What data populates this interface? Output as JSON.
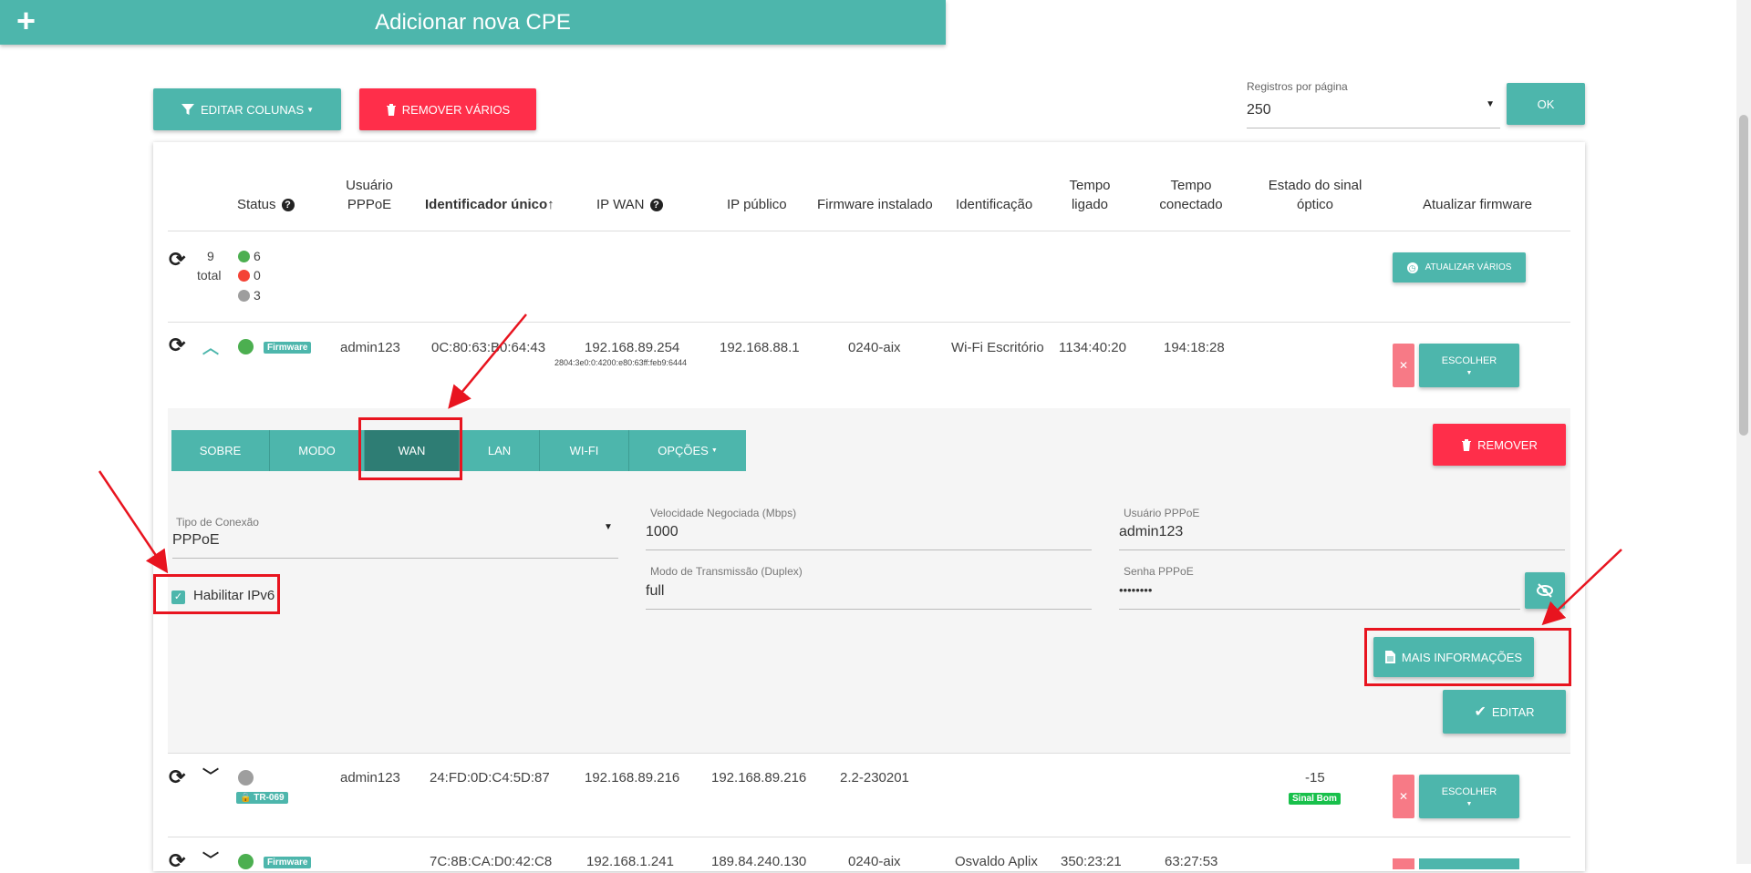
{
  "top": {
    "add_cpe_label": "Adicionar nova CPE",
    "edit_columns_label": "EDITAR COLUNAS",
    "remove_many_label": "REMOVER VÁRIOS",
    "per_page_label": "Registros por página",
    "per_page_value": "250",
    "ok_label": "OK"
  },
  "table": {
    "headers": {
      "status": "Status",
      "pppoe_line1": "Usuário",
      "pppoe_line2": "PPPoE",
      "unique_id": "Identificador único↑",
      "ip_wan": "IP WAN",
      "ip_public": "IP público",
      "firmware": "Firmware instalado",
      "identification": "Identificação",
      "uptime_line1": "Tempo",
      "uptime_line2": "ligado",
      "connected_line1": "Tempo",
      "connected_line2": "conectado",
      "signal_line1": "Estado do sinal",
      "signal_line2": "óptico",
      "update_fw": "Atualizar firmware"
    },
    "summary": {
      "count": "9",
      "total_label": "total",
      "online": "6",
      "offline": "0",
      "unknown": "3",
      "update_many_label": "ATUALIZAR VÁRIOS"
    },
    "rows": [
      {
        "badge": "Firmware",
        "pppoe": "admin123",
        "id": "0C:80:63:B0:64:43",
        "ip_wan": "192.168.89.254",
        "ipv6": "2804:3e0:0:4200:e80:63ff:feb9:6444",
        "ip_public": "192.168.88.1",
        "firmware": "0240-aix",
        "identification": "Wi-Fi Escritório",
        "uptime": "1134:40:20",
        "connected": "194:18:28",
        "choose_label": "ESCOLHER"
      },
      {
        "badge": "TR-069",
        "pppoe": "admin123",
        "id": "24:FD:0D:C4:5D:87",
        "ip_wan": "192.168.89.216",
        "ip_public": "192.168.89.216",
        "firmware": "2.2-230201",
        "signal": "-15",
        "signal_badge": "Sinal Bom",
        "choose_label": "ESCOLHER"
      },
      {
        "badge": "Firmware",
        "id": "7C:8B:CA:D0:42:C8",
        "ip_wan": "192.168.1.241",
        "ip_public": "189.84.240.130",
        "firmware": "0240-aix",
        "identification": "Osvaldo Aplix",
        "uptime": "350:23:21",
        "connected": "63:27:53"
      }
    ]
  },
  "detail": {
    "tabs": [
      "SOBRE",
      "MODO",
      "WAN",
      "LAN",
      "WI-FI",
      "OPÇÕES"
    ],
    "active_tab": "WAN",
    "remove_label": "REMOVER",
    "conn_type_label": "Tipo de Conexão",
    "conn_type_value": "PPPoE",
    "ipv6_label": "Habilitar IPv6",
    "speed_label": "Velocidade Negociada (Mbps)",
    "speed_value": "1000",
    "duplex_label": "Modo de Transmissão (Duplex)",
    "duplex_value": "full",
    "pppoe_user_label": "Usuário PPPoE",
    "pppoe_user_value": "admin123",
    "pppoe_pass_label": "Senha PPPoE",
    "pppoe_pass_value": "••••••••",
    "more_info_label": "MAIS INFORMAÇÕES",
    "edit_label": "EDITAR"
  },
  "colors": {
    "teal": "#4db6ac",
    "teal_dark": "#2e7d74",
    "red": "#ff2e4a",
    "green_status": "#4caf50",
    "red_status": "#f44336",
    "grey_status": "#9e9e9e",
    "annotation": "#e8141f"
  }
}
